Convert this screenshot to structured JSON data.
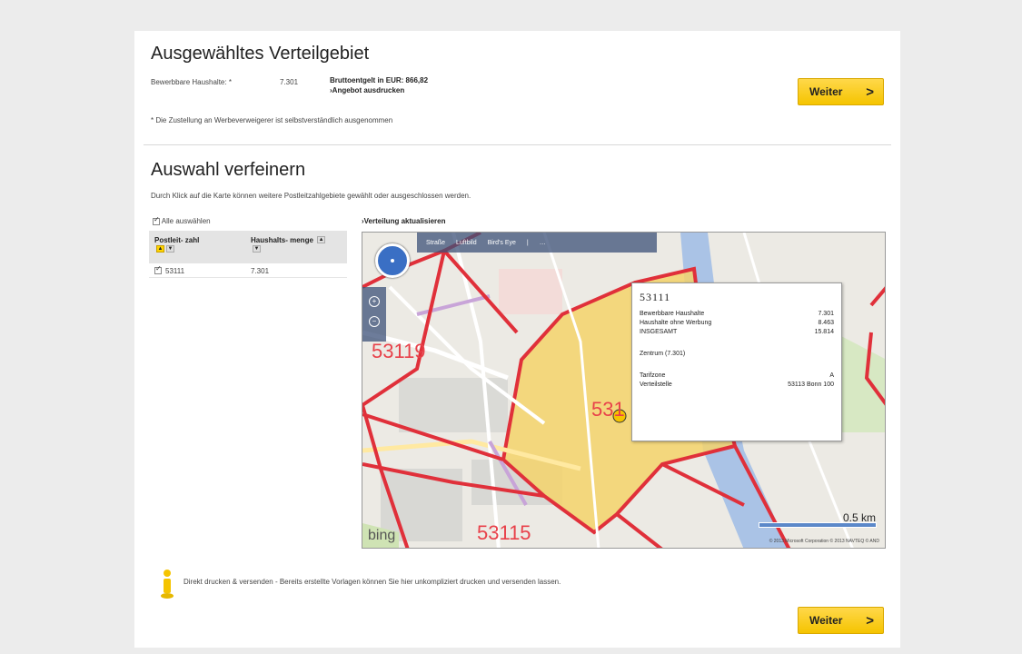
{
  "section1": {
    "title": "Ausgewähltes Verteilgebiet",
    "households_label": "Bewerbbare Haushalte: *",
    "households_value": "7.301",
    "price_line": "Bruttoentgelt in EUR: 866,82",
    "print_offer_link": "›Angebot ausdrucken",
    "footnote": "* Die Zustellung an Werbeverweigerer ist selbstverständlich ausgenommen",
    "next_button": "Weiter"
  },
  "section2": {
    "title": "Auswahl verfeinern",
    "description": "Durch Klick auf die Karte können weitere Postleitzahlgebiete gewählt oder ausgeschlossen werden.",
    "select_all_label": "Alle auswählen",
    "refresh_link": "›Verteilung aktualisieren",
    "table": {
      "col1": "Postleit- zahl",
      "col2": "Haushalts- menge",
      "rows": [
        {
          "plz": "53111",
          "count": "7.301"
        }
      ]
    }
  },
  "map": {
    "toolbar": [
      "Straße",
      "Luftbild",
      "Bird's Eye",
      "|",
      "…"
    ],
    "labels": {
      "west": "53119",
      "center": "531",
      "south": "53115"
    },
    "popup": {
      "title": "53111",
      "rows": [
        {
          "label": "Bewerbbare Haushalte",
          "value": "7.301"
        },
        {
          "label": "Haushalte ohne Werbung",
          "value": "8.463"
        },
        {
          "label": "INSGESAMT",
          "value": "15.814"
        }
      ],
      "district": "Zentrum (7.301)",
      "tariff_label": "Tarifzone",
      "tariff_value": "A",
      "office_label": "Verteilstelle",
      "office_value": "53113 Bonn 100"
    },
    "brand": "bing",
    "scale": "0.5 km",
    "copyright": "© 2013 Microsoft Corporation  © 2013 NAVTEQ  © AND"
  },
  "footer": {
    "notice": "Direkt drucken & versenden - Bereits erstellte Vorlagen können Sie hier unkompliziert drucken und versenden lassen.",
    "next_button": "Weiter"
  },
  "colors": {
    "accent": "#ffd400",
    "border_red": "#e0303a",
    "area_fill": "#f5d46b"
  }
}
